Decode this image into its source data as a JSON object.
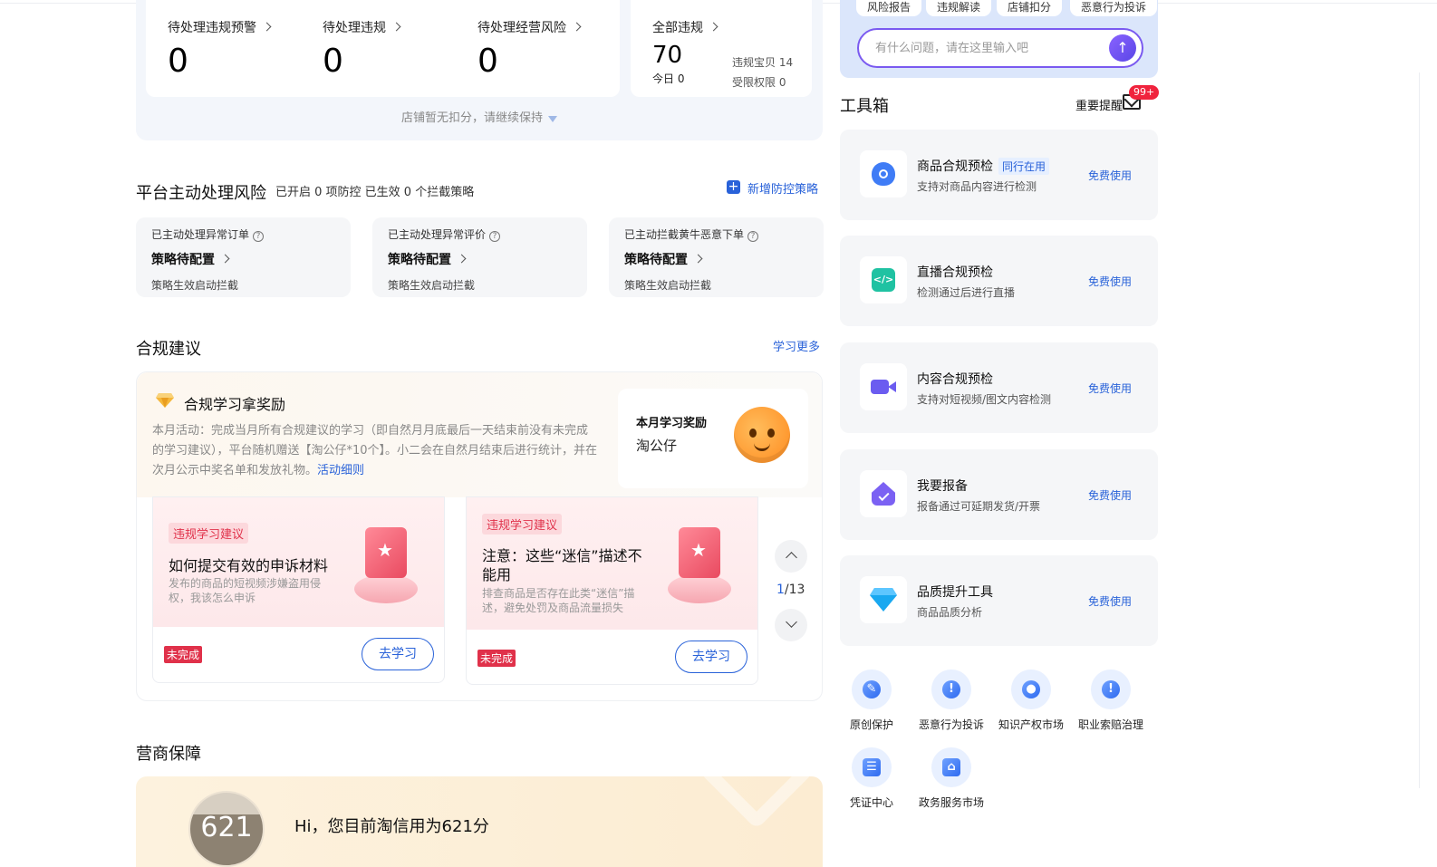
{
  "violations": {
    "pending_warning": {
      "label": "待处理违规预警",
      "value": "0"
    },
    "pending_violation": {
      "label": "待处理违规",
      "value": "0"
    },
    "pending_risk": {
      "label": "待处理经营风险",
      "value": "0"
    },
    "all": {
      "label": "全部违规",
      "value": "70",
      "today": "今日 0",
      "item_violation": "违规宝贝 14",
      "restricted": "受限权限 0"
    },
    "footer": "店铺暂无扣分，请继续保持"
  },
  "platform_risk": {
    "title": "平台主动处理风险",
    "summary": "已开启 0 项防控 已生效 0 个拦截策略",
    "add_label": "新增防控策略",
    "cards": [
      {
        "title": "已主动处理异常订单",
        "status": "策略待配置",
        "footer": "策略生效启动拦截"
      },
      {
        "title": "已主动处理异常评价",
        "status": "策略待配置",
        "footer": "策略生效启动拦截"
      },
      {
        "title": "已主动拦截黄牛恶意下单",
        "status": "策略待配置",
        "footer": "策略生效启动拦截"
      }
    ]
  },
  "compliance": {
    "title": "合规建议",
    "more_label": "学习更多",
    "reward_title": "合规学习拿奖励",
    "desc": "本月活动：完成当月所有合规建议的学习（即自然月月底最后一天结束前没有未完成的学习建议），平台随机赠送【淘公仔*10个】。小二会在自然月结束后进行统计，并在次月公示中奖名单和发放礼物。",
    "desc_link": "活动细则",
    "month_reward_label": "本月学习奖励",
    "month_reward_value": "淘公仔",
    "lessons": [
      {
        "tag": "违规学习建议",
        "title": "如何提交有效的申诉材料",
        "desc": "发布的商品的短视频涉嫌盗用侵权，我该怎么申诉",
        "status": "未完成",
        "button": "去学习"
      },
      {
        "tag": "违规学习建议",
        "title": "注意：这些“迷信”描述不能用",
        "desc": "排查商品是否存在此类“迷信”描述，避免处罚及商品流量损失",
        "status": "未完成",
        "button": "去学习"
      }
    ],
    "page_current": "1",
    "page_total": "/13"
  },
  "guarantee": {
    "title": "营商保障",
    "score": "621",
    "greeting": "Hi，您目前淘信用为621分"
  },
  "assistant": {
    "chips": [
      "风险报告",
      "违规解读",
      "店铺扣分",
      "恶意行为投诉"
    ],
    "placeholder": "有什么问题，请在这里输入吧"
  },
  "toolbox": {
    "title": "工具箱",
    "reminder_label": "重要提醒",
    "reminder_badge": "99+",
    "tools": [
      {
        "title": "商品合规预检",
        "badge": "同行在用",
        "desc": "支持对商品内容进行检测",
        "action": "免费使用",
        "icon": "shield-search-icon",
        "color": "#3f7cf6"
      },
      {
        "title": "直播合规预检",
        "badge": "",
        "desc": "检测通过后进行直播",
        "action": "免费使用",
        "icon": "code-icon",
        "color": "#1fc2a2"
      },
      {
        "title": "内容合规预检",
        "badge": "",
        "desc": "支持对短视频/图文内容检测",
        "action": "免费使用",
        "icon": "video-camera-icon",
        "color": "#6b5cf0"
      },
      {
        "title": "我要报备",
        "badge": "",
        "desc": "报备通过可延期发货/开票",
        "action": "免费使用",
        "icon": "house-check-icon",
        "color": "#7b61f3"
      },
      {
        "title": "品质提升工具",
        "badge": "",
        "desc": "商品品质分析",
        "action": "免费使用",
        "icon": "diamond-icon",
        "color": "#19a8f0"
      }
    ],
    "quick_links": [
      {
        "label": "原创保护",
        "icon": "edit-icon",
        "glyph": "✎"
      },
      {
        "label": "恶意行为投诉",
        "icon": "alert-icon",
        "glyph": "!"
      },
      {
        "label": "知识产权市场",
        "icon": "bulb-icon",
        "glyph": "●"
      },
      {
        "label": "职业索赔治理",
        "icon": "alert-icon",
        "glyph": "!"
      },
      {
        "label": "凭证中心",
        "icon": "ticket-icon",
        "glyph": "☰"
      },
      {
        "label": "政务服务市场",
        "icon": "government-icon",
        "glyph": "⌂"
      }
    ]
  }
}
